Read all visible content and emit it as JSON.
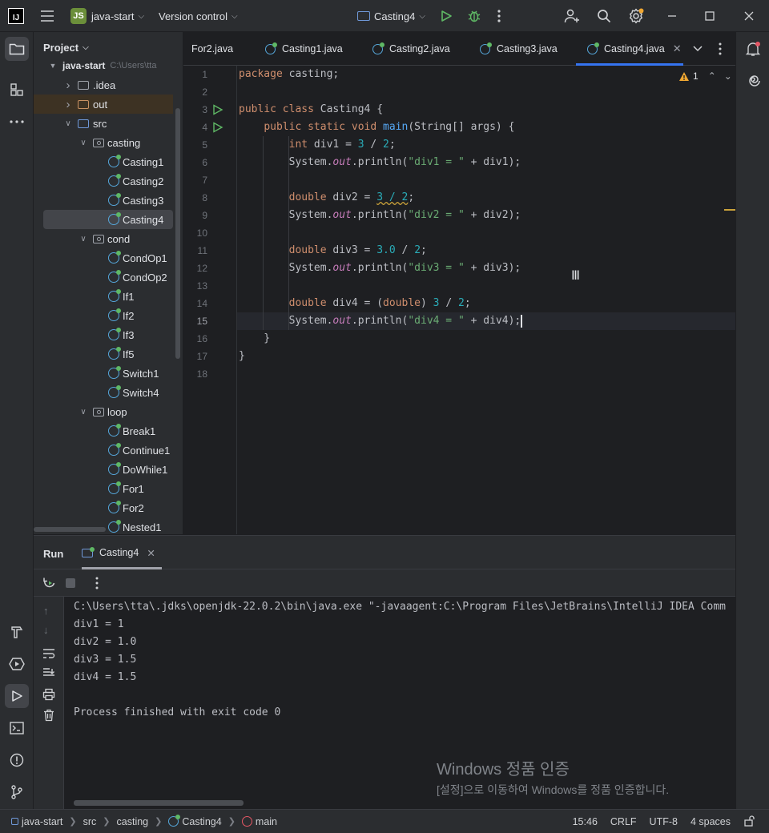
{
  "titlebar": {
    "project_badge": "JS",
    "project_name": "java-start",
    "version_control": "Version control",
    "run_config": "Casting4"
  },
  "project_panel": {
    "title": "Project",
    "root": "java-start",
    "root_path": "C:\\Users\\tta",
    "items": [
      {
        "label": ".idea"
      },
      {
        "label": "out"
      },
      {
        "label": "src"
      },
      {
        "label": "casting"
      },
      {
        "label": "Casting1"
      },
      {
        "label": "Casting2"
      },
      {
        "label": "Casting3"
      },
      {
        "label": "Casting4"
      },
      {
        "label": "cond"
      },
      {
        "label": "CondOp1"
      },
      {
        "label": "CondOp2"
      },
      {
        "label": "If1"
      },
      {
        "label": "If2"
      },
      {
        "label": "If3"
      },
      {
        "label": "If5"
      },
      {
        "label": "Switch1"
      },
      {
        "label": "Switch4"
      },
      {
        "label": "loop"
      },
      {
        "label": "Break1"
      },
      {
        "label": "Continue1"
      },
      {
        "label": "DoWhile1"
      },
      {
        "label": "For1"
      },
      {
        "label": "For2"
      },
      {
        "label": "Nested1"
      }
    ]
  },
  "tabs": [
    {
      "label": "For2.java"
    },
    {
      "label": "Casting1.java"
    },
    {
      "label": "Casting2.java"
    },
    {
      "label": "Casting3.java"
    },
    {
      "label": "Casting4.java"
    }
  ],
  "editor": {
    "warning_count": "1",
    "line_numbers": [
      "1",
      "2",
      "3",
      "4",
      "5",
      "6",
      "7",
      "8",
      "9",
      "10",
      "11",
      "12",
      "13",
      "14",
      "15",
      "16",
      "17",
      "18"
    ],
    "current_line": "15"
  },
  "run_panel": {
    "title": "Run",
    "tab_label": "Casting4",
    "console": [
      "C:\\Users\\tta\\.jdks\\openjdk-22.0.2\\bin\\java.exe \"-javaagent:C:\\Program Files\\JetBrains\\IntelliJ IDEA Comm",
      "div1 = 1",
      "div2 = 1.0",
      "div3 = 1.5",
      "div4 = 1.5",
      "",
      "Process finished with exit code 0"
    ]
  },
  "watermark": {
    "line1": "Windows 정품 인증",
    "line2": "[설정]으로 이동하여 Windows를 정품 인증합니다."
  },
  "statusbar": {
    "crumbs": [
      "java-start",
      "src",
      "casting",
      "Casting4",
      "main"
    ],
    "position": "15:46",
    "line_sep": "CRLF",
    "encoding": "UTF-8",
    "indent": "4 spaces"
  },
  "colors": {
    "accent": "#3574f0",
    "keyword": "#cf8e6d",
    "string": "#6aab73",
    "number": "#2aacb8",
    "method": "#56a8f5",
    "static_field": "#c77dbb"
  }
}
